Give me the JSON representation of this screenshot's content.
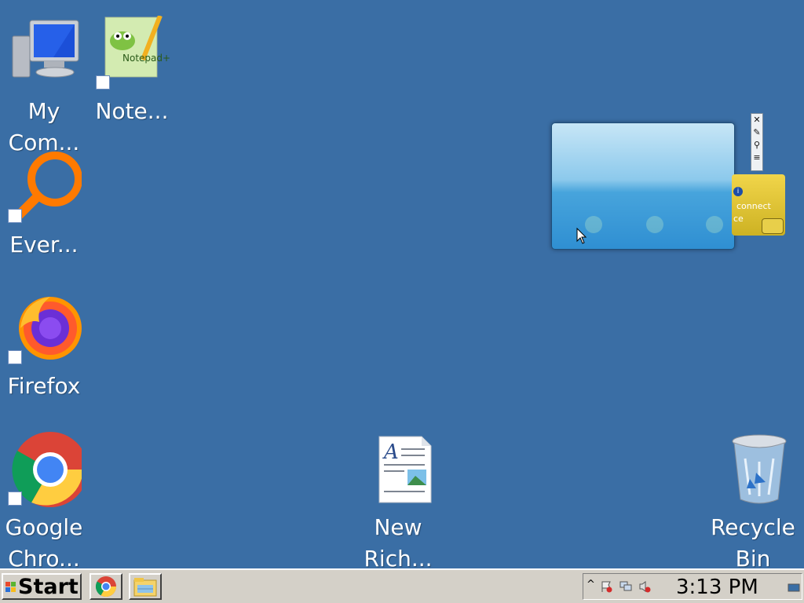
{
  "desktop": {
    "background": "#3a6ea5",
    "icons": [
      {
        "label": "My\nCom...",
        "icon": "computer-icon"
      },
      {
        "label": "Note...",
        "icon": "notepad-plus-plus-icon"
      },
      {
        "label": "Ever...",
        "icon": "everything-search-icon"
      },
      {
        "label": "Firefox",
        "icon": "firefox-icon"
      },
      {
        "label": "Google\nChro...",
        "icon": "chrome-icon"
      },
      {
        "label": "New\nRich...",
        "icon": "rich-text-document-icon"
      },
      {
        "label": "Recycle\nBin",
        "icon": "recycle-bin-icon"
      }
    ]
  },
  "gadgets": {
    "card_text_1": "connect",
    "card_text_2": "ce",
    "toolbar": [
      "close-icon",
      "options-icon",
      "drag-icon"
    ]
  },
  "taskbar": {
    "start_label": "Start",
    "quick_launch": [
      "chrome-icon",
      "file-explorer-icon"
    ],
    "tray_chevron": "^",
    "clock": "3:13 PM"
  }
}
